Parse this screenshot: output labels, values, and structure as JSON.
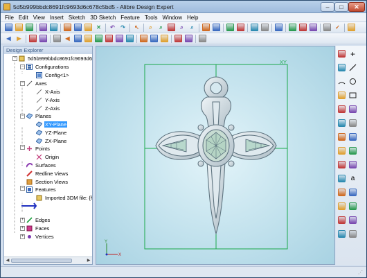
{
  "window": {
    "title": "5d5b999bbdc8691fc9693d6c678c5bd5 - Alibre Design Expert",
    "close_glyph": "✕",
    "min_glyph": "–",
    "max_glyph": "□"
  },
  "menu": [
    "File",
    "Edit",
    "View",
    "Insert",
    "Sketch",
    "3D Sketch",
    "Feature",
    "Tools",
    "Window",
    "Help"
  ],
  "explorer": {
    "header": "Design Explorer",
    "root": "5d5b999bbdc8691fc9693d6c6",
    "configurations": "Configurations",
    "config1": "Config<1>",
    "axes": "Axes",
    "x_axis": "X-Axis",
    "y_axis": "Y-Axis",
    "z_axis": "Z-Axis",
    "planes": "Planes",
    "xy_plane": "XY-Plane",
    "yz_plane": "YZ-Plane",
    "zx_plane": "ZX-Plane",
    "points": "Points",
    "origin": "Origin",
    "surfaces": "Surfaces",
    "redline_views": "Redline Views",
    "section_views": "Section Views",
    "features": "Features",
    "imported": "Imported 3DM file: {fo",
    "edges": "Edges",
    "faces": "Faces",
    "vertices": "Vertices"
  },
  "viewport": {
    "plane_label": "XY",
    "triad_x": "X",
    "triad_y": "Y",
    "frame_color": "#1aa84a",
    "model_color": "#c9d7de",
    "model_shade": "#5f7480"
  },
  "icons": {
    "toolbar1": [
      "new-document-icon",
      "open-folder-icon",
      "save-icon",
      "sep",
      "print-icon",
      "print-preview-icon",
      "sep",
      "cut-icon",
      "copy-icon",
      "paste-icon",
      "delete-icon",
      "sep",
      "undo-icon",
      "redo-icon",
      "sep",
      "select-arrow-icon",
      "sep",
      "zoom-in-icon",
      "zoom-out-icon",
      "pan-icon",
      "zoom-window-icon",
      "zoom-fit-icon",
      "sep",
      "previous-view-icon",
      "next-view-icon",
      "sep",
      "rotate-icon",
      "spin-icon",
      "sep",
      "shaded-icon",
      "wireframe-icon",
      "sep",
      "measure-icon",
      "sep",
      "reference-axis-icon",
      "reference-plane-icon",
      "reference-point-icon",
      "sep",
      "grid-icon",
      "checkmark-icon",
      "sep",
      "material-icon"
    ],
    "toolbar2": [
      "nav-back-icon",
      "nav-forward-icon",
      "sep",
      "sketch-a-icon",
      "sketch-b-icon",
      "sep",
      "view-front-icon",
      "view-back-icon",
      "view-top-icon",
      "view-bottom-icon",
      "view-left-icon",
      "view-right-icon",
      "view-iso-icon",
      "view-dimetric-icon",
      "sep",
      "display-a-icon",
      "display-b-icon",
      "display-c-icon",
      "sep",
      "section-icon",
      "explode-icon",
      "sep",
      "cut-plane-icon"
    ]
  },
  "vtools": [
    "layout-icon",
    "plus-icon",
    "cube-icon",
    "line-icon",
    "arc-icon",
    "circle-icon",
    "ellipse-icon",
    "rectangle-icon",
    "polygon-icon",
    "spline-icon",
    "point-icon",
    "dimension-icon",
    "trim-icon",
    "extend-icon",
    "offset-icon",
    "fillet-icon",
    "chamfer-icon",
    "mirror-icon",
    "pattern-icon",
    "text-icon",
    "move-icon",
    "rotate-sketch-icon",
    "scale-icon",
    "constraint-icon",
    "project-icon",
    "grid-snap-icon",
    "undo-sketch-icon",
    "exit-sketch-icon"
  ]
}
